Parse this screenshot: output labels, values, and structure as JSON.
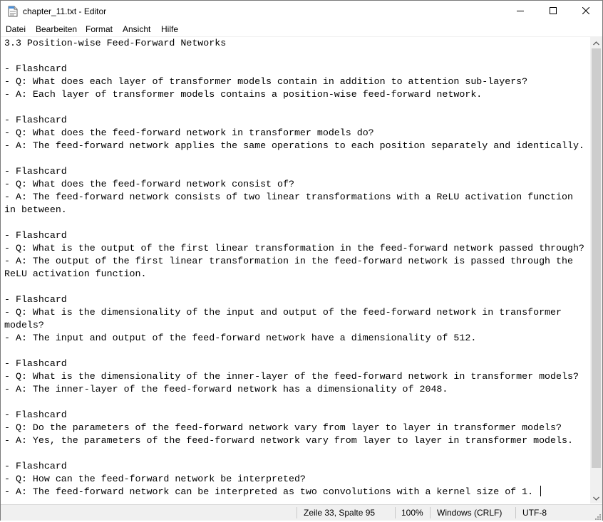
{
  "window": {
    "title": "chapter_11.txt - Editor",
    "icons": {
      "app": "notepad-icon",
      "minimize": "minimize-icon",
      "maximize": "maximize-icon",
      "close": "close-icon"
    }
  },
  "menu": {
    "items": [
      "Datei",
      "Bearbeiten",
      "Format",
      "Ansicht",
      "Hilfe"
    ]
  },
  "editor": {
    "lines": [
      "3.3 Position-wise Feed-Forward Networks",
      "",
      "- Flashcard",
      "- Q: What does each layer of transformer models contain in addition to attention sub-layers?",
      "- A: Each layer of transformer models contains a position-wise feed-forward network.",
      "",
      "- Flashcard",
      "- Q: What does the feed-forward network in transformer models do?",
      "- A: The feed-forward network applies the same operations to each position separately and identically.",
      "",
      "- Flashcard",
      "- Q: What does the feed-forward network consist of?",
      "- A: The feed-forward network consists of two linear transformations with a ReLU activation function",
      "in between.",
      "",
      "- Flashcard",
      "- Q: What is the output of the first linear transformation in the feed-forward network passed through?",
      "- A: The output of the first linear transformation in the feed-forward network is passed through the",
      "ReLU activation function.",
      "",
      "- Flashcard",
      "- Q: What is the dimensionality of the input and output of the feed-forward network in transformer",
      "models?",
      "- A: The input and output of the feed-forward network have a dimensionality of 512.",
      "",
      "- Flashcard",
      "- Q: What is the dimensionality of the inner-layer of the feed-forward network in transformer models?",
      "- A: The inner-layer of the feed-forward network has a dimensionality of 2048.",
      "",
      "- Flashcard",
      "- Q: Do the parameters of the feed-forward network vary from layer to layer in transformer models?",
      "- A: Yes, the parameters of the feed-forward network vary from layer to layer in transformer models.",
      "",
      "- Flashcard",
      "- Q: How can the feed-forward network be interpreted?",
      "- A: The feed-forward network can be interpreted as two convolutions with a kernel size of 1. "
    ]
  },
  "scrollbar": {
    "up_icon": "scroll-up-arrow-icon",
    "down_icon": "scroll-down-arrow-icon"
  },
  "status": {
    "position": "Zeile 33, Spalte 95",
    "zoom": "100%",
    "line_ending": "Windows (CRLF)",
    "encoding": "UTF-8"
  }
}
